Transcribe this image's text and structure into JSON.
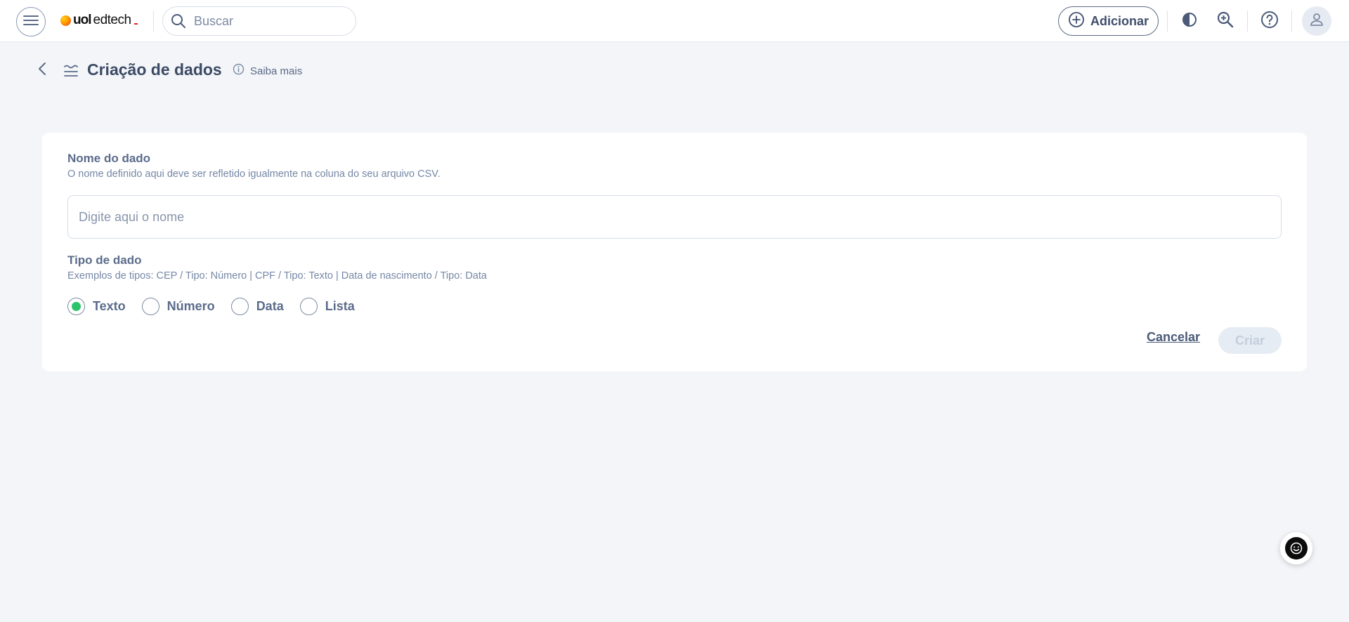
{
  "app": {
    "logo": {
      "part1": "uol",
      "part2": "edtech"
    },
    "search": {
      "placeholder": "Buscar",
      "value": ""
    },
    "add_button_label": "Adicionar"
  },
  "icons": {
    "menu": "hamburger-menu-icon",
    "search": "search-icon",
    "add": "plus-circle-icon",
    "contrast": "contrast-icon",
    "zoom": "zoom-in-icon",
    "help": "help-circle-icon",
    "avatar": "user-icon",
    "back": "chevron-left-icon",
    "page": "data-layers-icon",
    "info": "info-icon",
    "chat": "smiley-chat-icon"
  },
  "page": {
    "title": "Criação de dados",
    "learn_more": "Saiba mais"
  },
  "form": {
    "name": {
      "label": "Nome do dado",
      "hint": "O nome definido aqui deve ser refletido igualmente na coluna do seu arquivo CSV.",
      "placeholder": "Digite aqui o nome",
      "value": ""
    },
    "type": {
      "label": "Tipo de dado",
      "hint": "Exemplos de tipos: CEP / Tipo: Número | CPF / Tipo: Texto | Data de nascimento / Tipo: Data",
      "options": [
        {
          "label": "Texto",
          "checked": true
        },
        {
          "label": "Número",
          "checked": false
        },
        {
          "label": "Data",
          "checked": false
        },
        {
          "label": "Lista",
          "checked": false
        }
      ]
    },
    "cancel_label": "Cancelar",
    "create_label": "Criar"
  },
  "colors": {
    "accent_green": "#2cc46b",
    "page_bg": "#f3f5f9",
    "text_primary": "#3c4a64"
  }
}
